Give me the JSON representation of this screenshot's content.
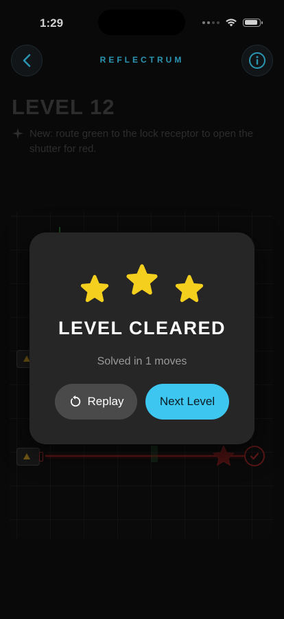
{
  "status_bar": {
    "time": "1:29",
    "battery_level": 0.9
  },
  "header": {
    "title": "REFLECTRUM",
    "back_icon": "chevron-left-icon",
    "info_icon": "info-icon"
  },
  "level": {
    "title": "LEVEL 12",
    "hint": "New: route green to the lock receptor to open the shutter for red."
  },
  "modal": {
    "title": "LEVEL CLEARED",
    "subtitle": "Solved in 1 moves",
    "stars_earned": 3,
    "stars_total": 3,
    "replay_label": "Replay",
    "next_label": "Next Level"
  },
  "colors": {
    "accent": "#3cc6f0",
    "title_cyan": "#35b8dc",
    "star_gold": "#f5cf1e",
    "laser_red": "#7a1a1a",
    "modal_bg": "#262626"
  }
}
